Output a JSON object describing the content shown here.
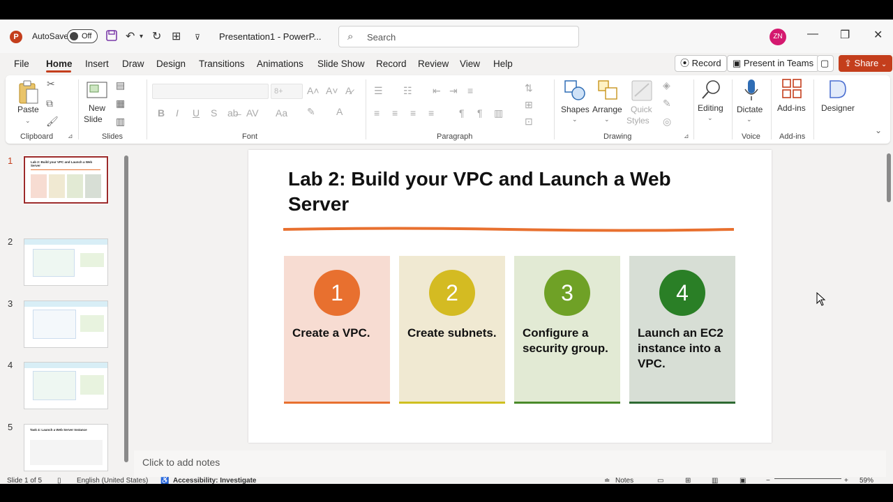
{
  "titlebar": {
    "autosave_label": "AutoSave",
    "autosave_state": "Off",
    "doc_title": "Presentation1  -  PowerP...",
    "search_placeholder": "Search",
    "user_initials": "ZN"
  },
  "menu": {
    "items": [
      "File",
      "Home",
      "Insert",
      "Draw",
      "Design",
      "Transitions",
      "Animations",
      "Slide Show",
      "Record",
      "Review",
      "View",
      "Help"
    ],
    "active": "Home",
    "record_label": "Record",
    "present_label": "Present in Teams",
    "share_label": "Share"
  },
  "ribbon": {
    "paste": "Paste",
    "new_slide_1": "New",
    "new_slide_2": "Slide",
    "font_size": "8+",
    "shapes": "Shapes",
    "arrange": "Arrange",
    "quick_styles_1": "Quick",
    "quick_styles_2": "Styles",
    "editing": "Editing",
    "dictate": "Dictate",
    "addins": "Add-ins",
    "designer": "Designer",
    "groups": {
      "clipboard": "Clipboard",
      "slides": "Slides",
      "font": "Font",
      "paragraph": "Paragraph",
      "drawing": "Drawing",
      "voice": "Voice",
      "addins": "Add-ins"
    }
  },
  "thumbnails": {
    "numbers": [
      "1",
      "2",
      "3",
      "4",
      "5"
    ],
    "thumb1_title": "Lab 2: Build your VPC and Launch a Web Server",
    "thumb5_title": "Task 4: Launch a Web Server Instance"
  },
  "slide": {
    "title": "Lab 2: Build your VPC and Launch a Web Server",
    "cards": [
      {
        "num": "1",
        "text": "Create a VPC.",
        "bg": "#f7dcd2",
        "circle": "#e8702f",
        "bottom": "#e8702f"
      },
      {
        "num": "2",
        "text": "Create subnets.",
        "bg": "#f0e9d2",
        "circle": "#d4bb22",
        "bottom": "#cfc020"
      },
      {
        "num": "3",
        "text": "Configure a security group.",
        "bg": "#e2ead4",
        "circle": "#6fa126",
        "bottom": "#4a8a2a"
      },
      {
        "num": "4",
        "text": "Launch an EC2 instance into a VPC.",
        "bg": "#d7ded5",
        "circle": "#2a7f26",
        "bottom": "#2e6a32"
      }
    ],
    "accent_line": "#e8702f"
  },
  "notes_placeholder": "Click to add notes",
  "status": {
    "slide_of": "Slide 1 of 5",
    "language": "English (United States)",
    "accessibility": "Accessibility: Investigate",
    "notes": "Notes",
    "zoom": "59%"
  }
}
